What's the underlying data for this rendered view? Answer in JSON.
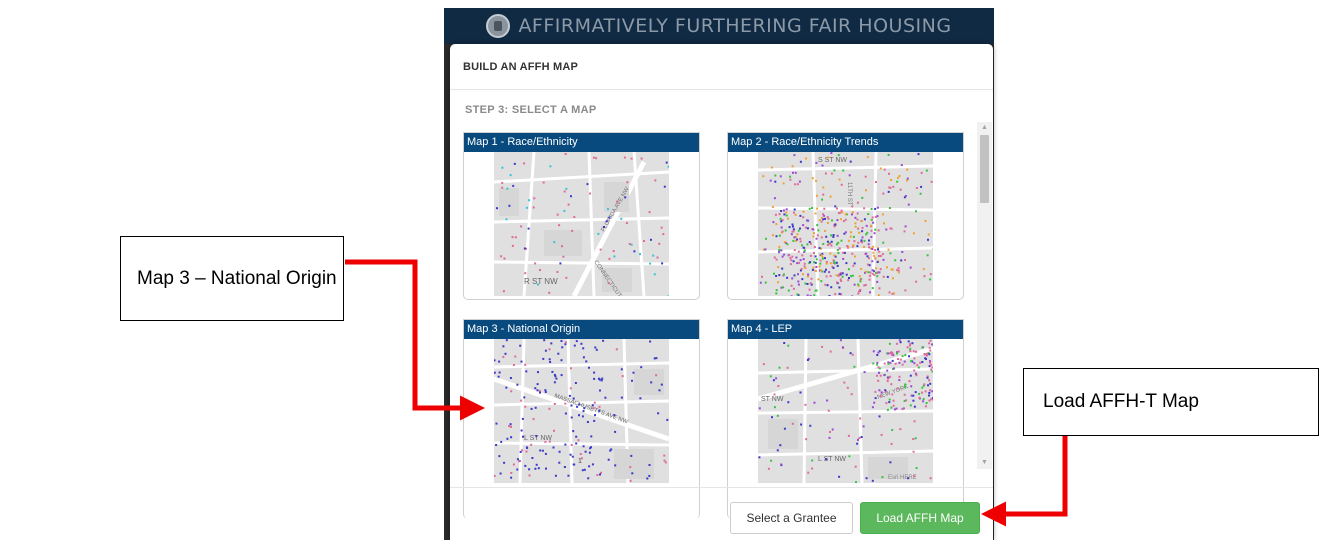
{
  "app": {
    "title": "AFFIRMATIVELY FURTHERING FAIR HOUSING",
    "logo_icon": "hud-seal-icon"
  },
  "modal": {
    "title": "BUILD AN AFFH MAP",
    "step_label": "STEP 3: SELECT A MAP",
    "maps": [
      {
        "label": "Map 1 - Race/Ethnicity",
        "street_labels": [
          "R ST NW",
          "FLORIDA AVE NW",
          "CONNECTICUT"
        ]
      },
      {
        "label": "Map 2 - Race/Ethnicity Trends",
        "street_labels": [
          "S ST NW",
          "11TH ST"
        ]
      },
      {
        "label": "Map 3 - National Origin",
        "street_labels": [
          "MASSACHUSETTS AVE NW",
          "L ST NW",
          "1"
        ]
      },
      {
        "label": "Map 4 - LEP",
        "street_labels": [
          "ST NW",
          "NEW YORK",
          "L ST NW",
          "Esri HERE"
        ]
      }
    ],
    "buttons": {
      "select_grantee": "Select a Grantee",
      "load_map": "Load AFFH Map"
    }
  },
  "annotations": {
    "left_callout": "Map 3 – National Origin",
    "right_callout": "Load AFFH-T Map"
  },
  "colors": {
    "header_bg": "#102a43",
    "card_header_bg": "#084a7e",
    "load_button": "#5cb85c",
    "arrow": "#ee0000"
  }
}
